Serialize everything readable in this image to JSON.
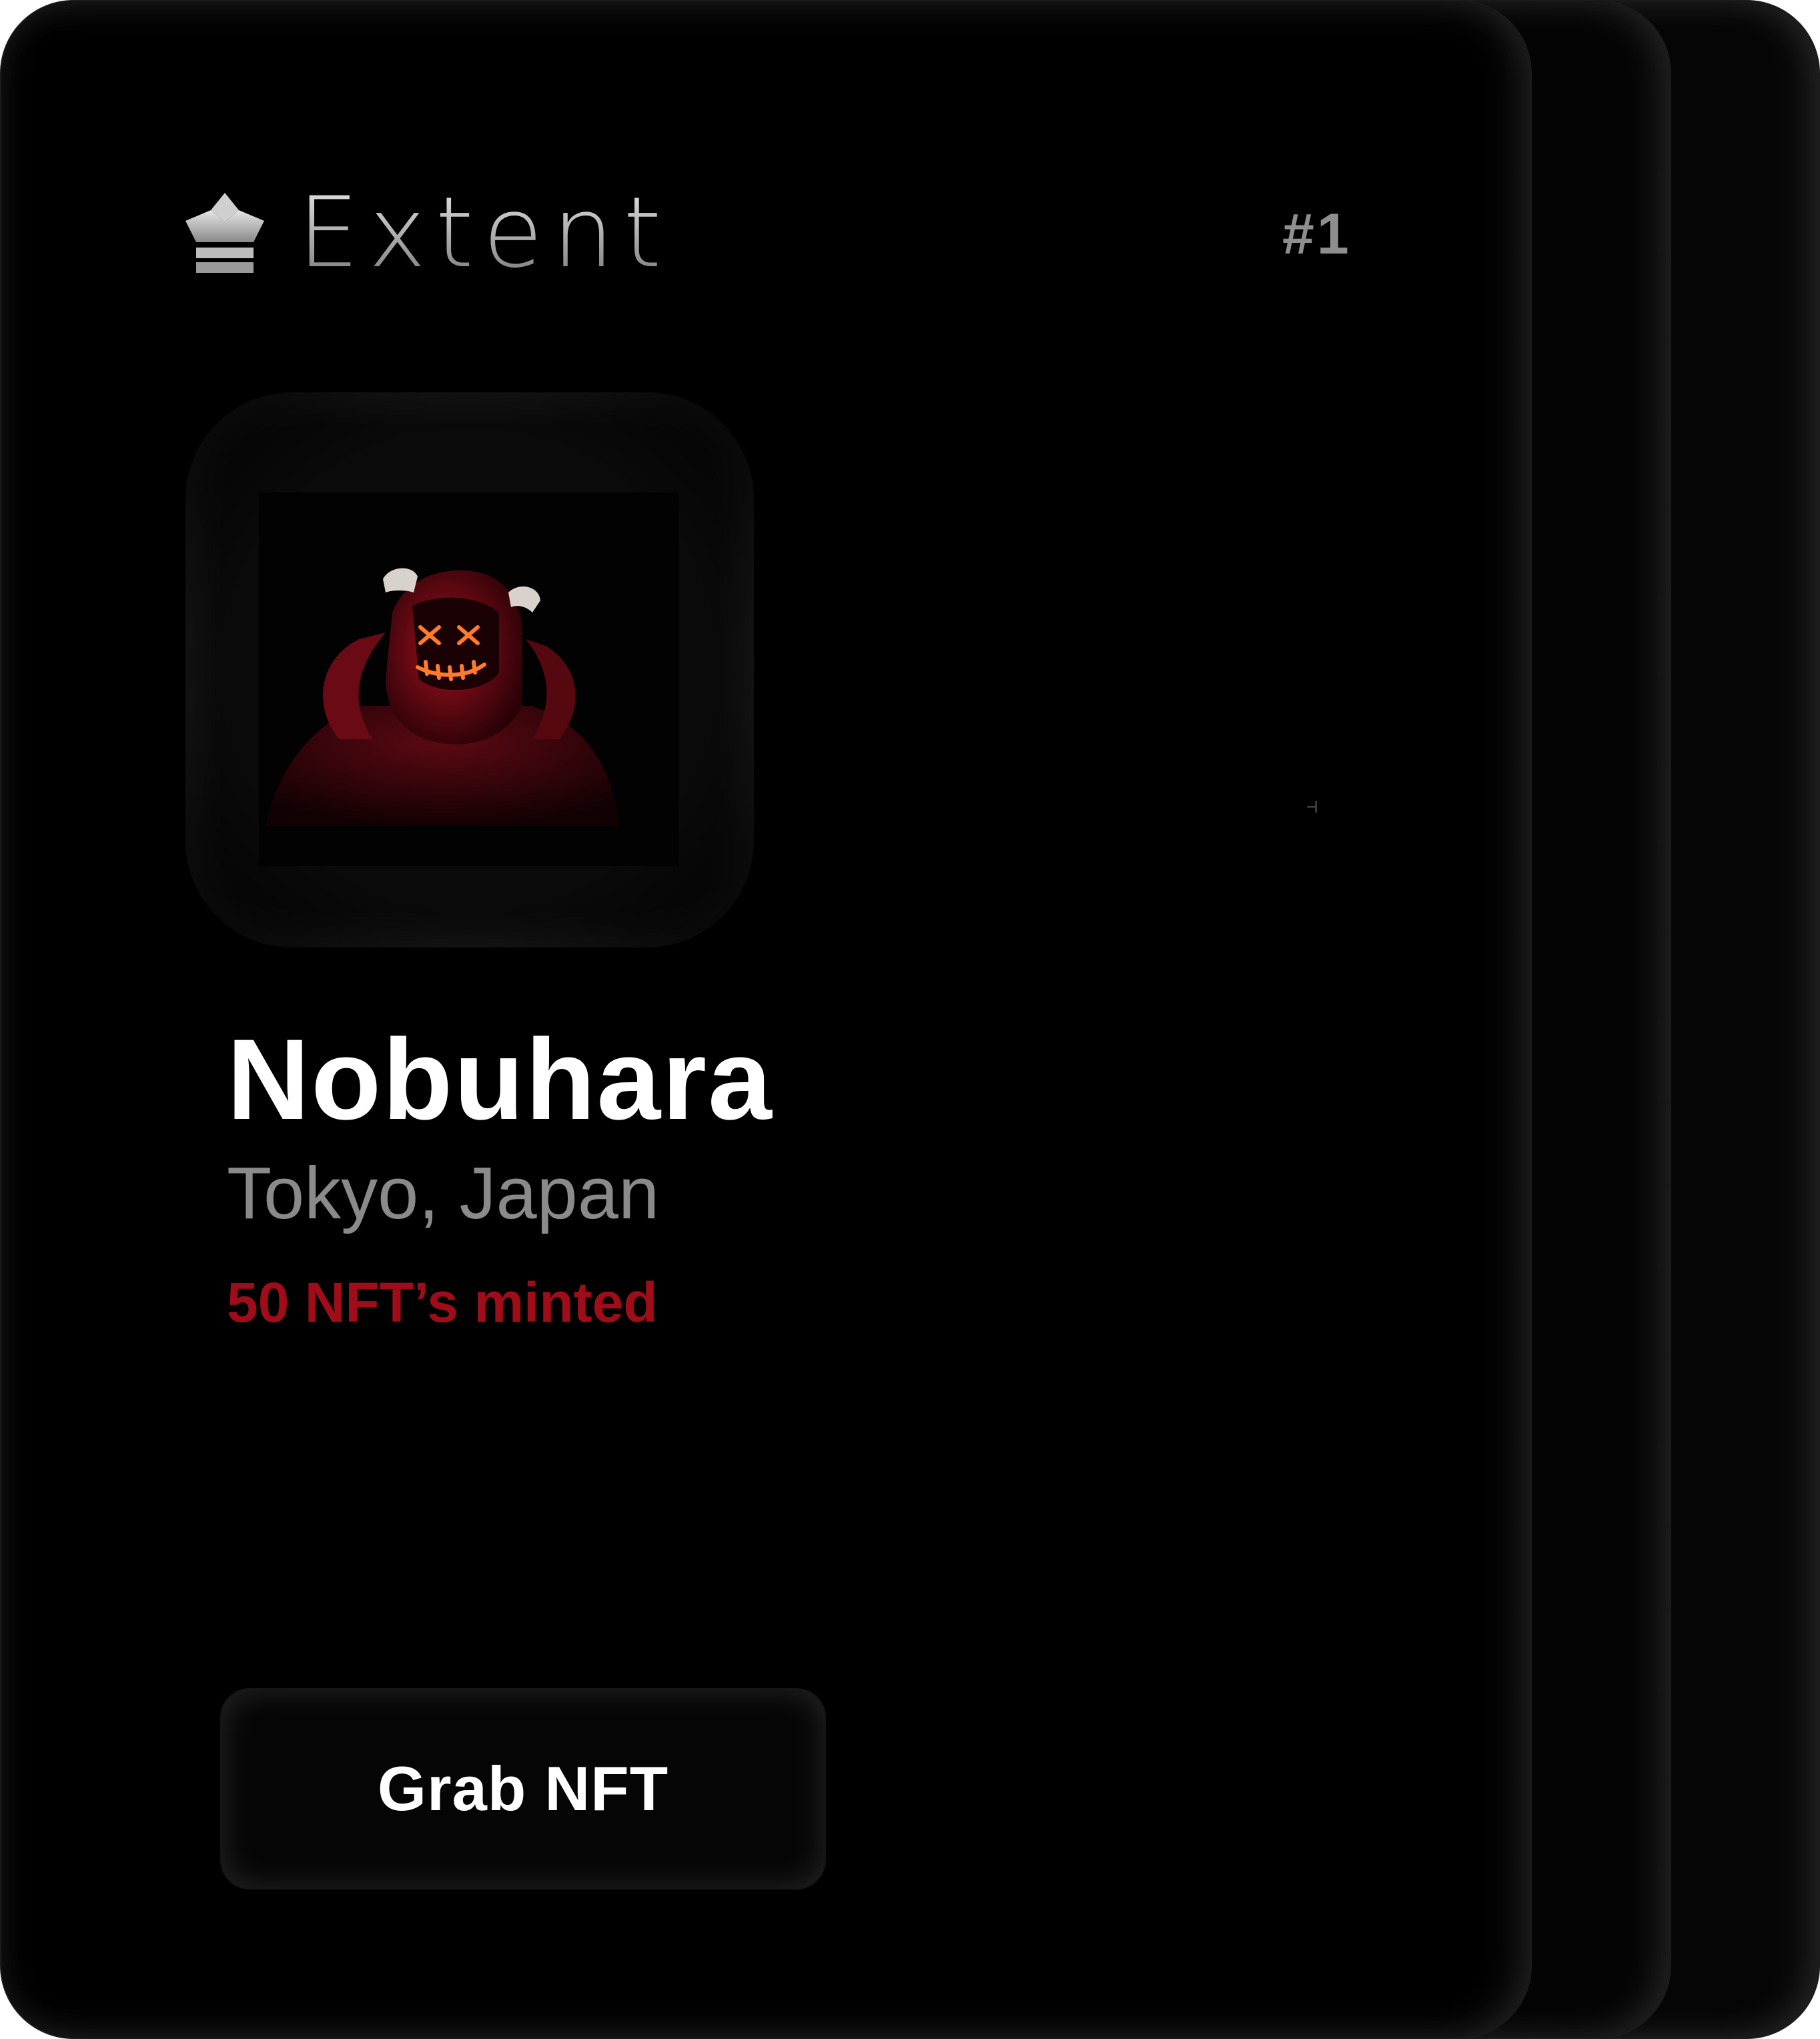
{
  "brand": {
    "name": "Extent",
    "logo_icon": "crown-icon"
  },
  "card": {
    "rank": "#1",
    "name": "Nobuhara",
    "location": "Tokyo, Japan",
    "minted": "50 NFT’s minted",
    "avatar_icon": "hooded-figure-image"
  },
  "actions": {
    "grab_label": "Grab NFT"
  },
  "colors": {
    "background": "#000000",
    "accent": "#a00d19",
    "text_primary": "#ffffff",
    "text_secondary": "#8a8a8a"
  }
}
